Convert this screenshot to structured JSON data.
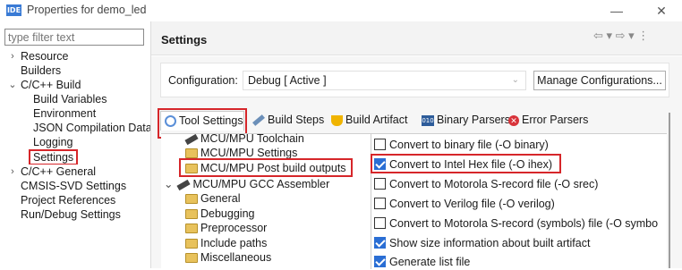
{
  "window": {
    "badge": "IDE",
    "title": "Properties for demo_led",
    "minimize": "—",
    "close": "✕"
  },
  "filter": {
    "placeholder": "type filter text"
  },
  "tree": [
    {
      "label": "Resource",
      "twisty": "›"
    },
    {
      "label": "Builders",
      "twisty": ""
    },
    {
      "label": "C/C++ Build",
      "twisty": "⌄"
    },
    {
      "label": "Build Variables"
    },
    {
      "label": "Environment"
    },
    {
      "label": "JSON Compilation Database"
    },
    {
      "label": "Logging"
    },
    {
      "label": "Settings"
    },
    {
      "label": "C/C++ General",
      "twisty": "›"
    },
    {
      "label": "CMSIS-SVD Settings",
      "twisty": ""
    },
    {
      "label": "Project References",
      "twisty": ""
    },
    {
      "label": "Run/Debug Settings",
      "twisty": ""
    }
  ],
  "header": {
    "title": "Settings",
    "nav": "⇦ ▾ ⇨ ▾ ⋮"
  },
  "configuration": {
    "label": "Configuration:",
    "value": "Debug  [ Active ]",
    "chevron": "⌄",
    "manage": "Manage Configurations..."
  },
  "tabs": [
    "Tool Settings",
    "Build Steps",
    "Build Artifact",
    "Binary Parsers",
    "Error Parsers"
  ],
  "icons": {
    "bin": "010",
    "err": "✕"
  },
  "subtree": [
    {
      "label": "MCU/MPU Toolchain"
    },
    {
      "label": "MCU/MPU Settings"
    },
    {
      "label": "MCU/MPU Post build outputs"
    },
    {
      "label": "MCU/MPU GCC Assembler",
      "twisty": "⌄"
    },
    {
      "label": "General"
    },
    {
      "label": "Debugging"
    },
    {
      "label": "Preprocessor"
    },
    {
      "label": "Include paths"
    },
    {
      "label": "Miscellaneous"
    }
  ],
  "options": [
    {
      "label": "Convert to binary file (-O binary)",
      "checked": false
    },
    {
      "label": "Convert to Intel Hex file (-O ihex)",
      "checked": true
    },
    {
      "label": "Convert to Motorola S-record file (-O srec)",
      "checked": false
    },
    {
      "label": "Convert to Verilog file (-O verilog)",
      "checked": false
    },
    {
      "label": "Convert to Motorola S-record (symbols) file (-O symbo",
      "checked": false
    },
    {
      "label": "Show size information about built artifact",
      "checked": true
    },
    {
      "label": "Generate list file",
      "checked": true
    }
  ],
  "colors": {
    "highlight": "#d6262a",
    "checkbox": "#2a6ed4"
  }
}
